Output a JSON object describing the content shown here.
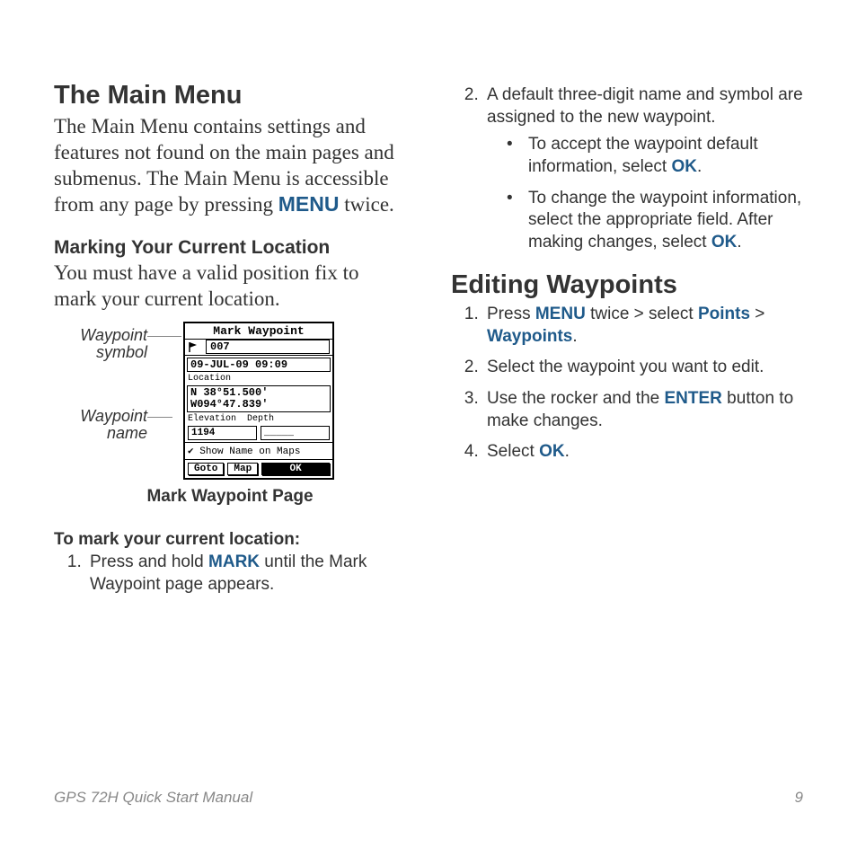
{
  "left": {
    "h1": "The Main Menu",
    "p1_a": "The Main Menu contains settings and features not found on the main pages and submenus. The Main Menu is accessible from any page by pressing ",
    "p1_kw": "MENU",
    "p1_b": " twice.",
    "h2": "Marking Your Current Location",
    "p2": "You must have a valid position fix to mark your current location.",
    "label_symbol": "Waypoint symbol",
    "label_name": "Waypoint name",
    "fig_caption": "Mark Waypoint Page",
    "instr_title": "To mark your current location:",
    "step1_a": "Press and hold ",
    "step1_kw": "MARK",
    "step1_b": " until the Mark Waypoint page appears."
  },
  "device": {
    "title": "Mark Waypoint",
    "name": "007",
    "date": "09-JUL-09 09:09",
    "loc_label": "Location",
    "lat": "N  38°51.500'",
    "lon": "W094°47.839'",
    "elev_label": "Elevation",
    "depth_label": "Depth",
    "elev": "1194",
    "depth": "_____",
    "checkbox": "Show Name on Maps",
    "btn_goto": "Goto",
    "btn_map": "Map",
    "btn_ok": "OK"
  },
  "right": {
    "step2": "A default three-digit name and symbol are assigned to the new waypoint.",
    "b1_a": "To accept the waypoint default information, select ",
    "b1_kw": "OK",
    "b1_b": ".",
    "b2_a": "To change the waypoint information, select the appropriate field. After making changes, select ",
    "b2_kw": "OK",
    "b2_b": ".",
    "h1": "Editing Waypoints",
    "e1_a": "Press ",
    "e1_kw1": "MENU",
    "e1_b": " twice > select ",
    "e1_kw2": "Points",
    "e1_c": " > ",
    "e1_kw3": "Waypoints",
    "e1_d": ".",
    "e2": "Select the waypoint you want to edit.",
    "e3_a": "Use the rocker and the ",
    "e3_kw": "ENTER",
    "e3_b": " button to make changes.",
    "e4_a": "Select ",
    "e4_kw": "OK",
    "e4_b": "."
  },
  "footer": {
    "left": "GPS 72H Quick Start Manual",
    "right": "9"
  }
}
